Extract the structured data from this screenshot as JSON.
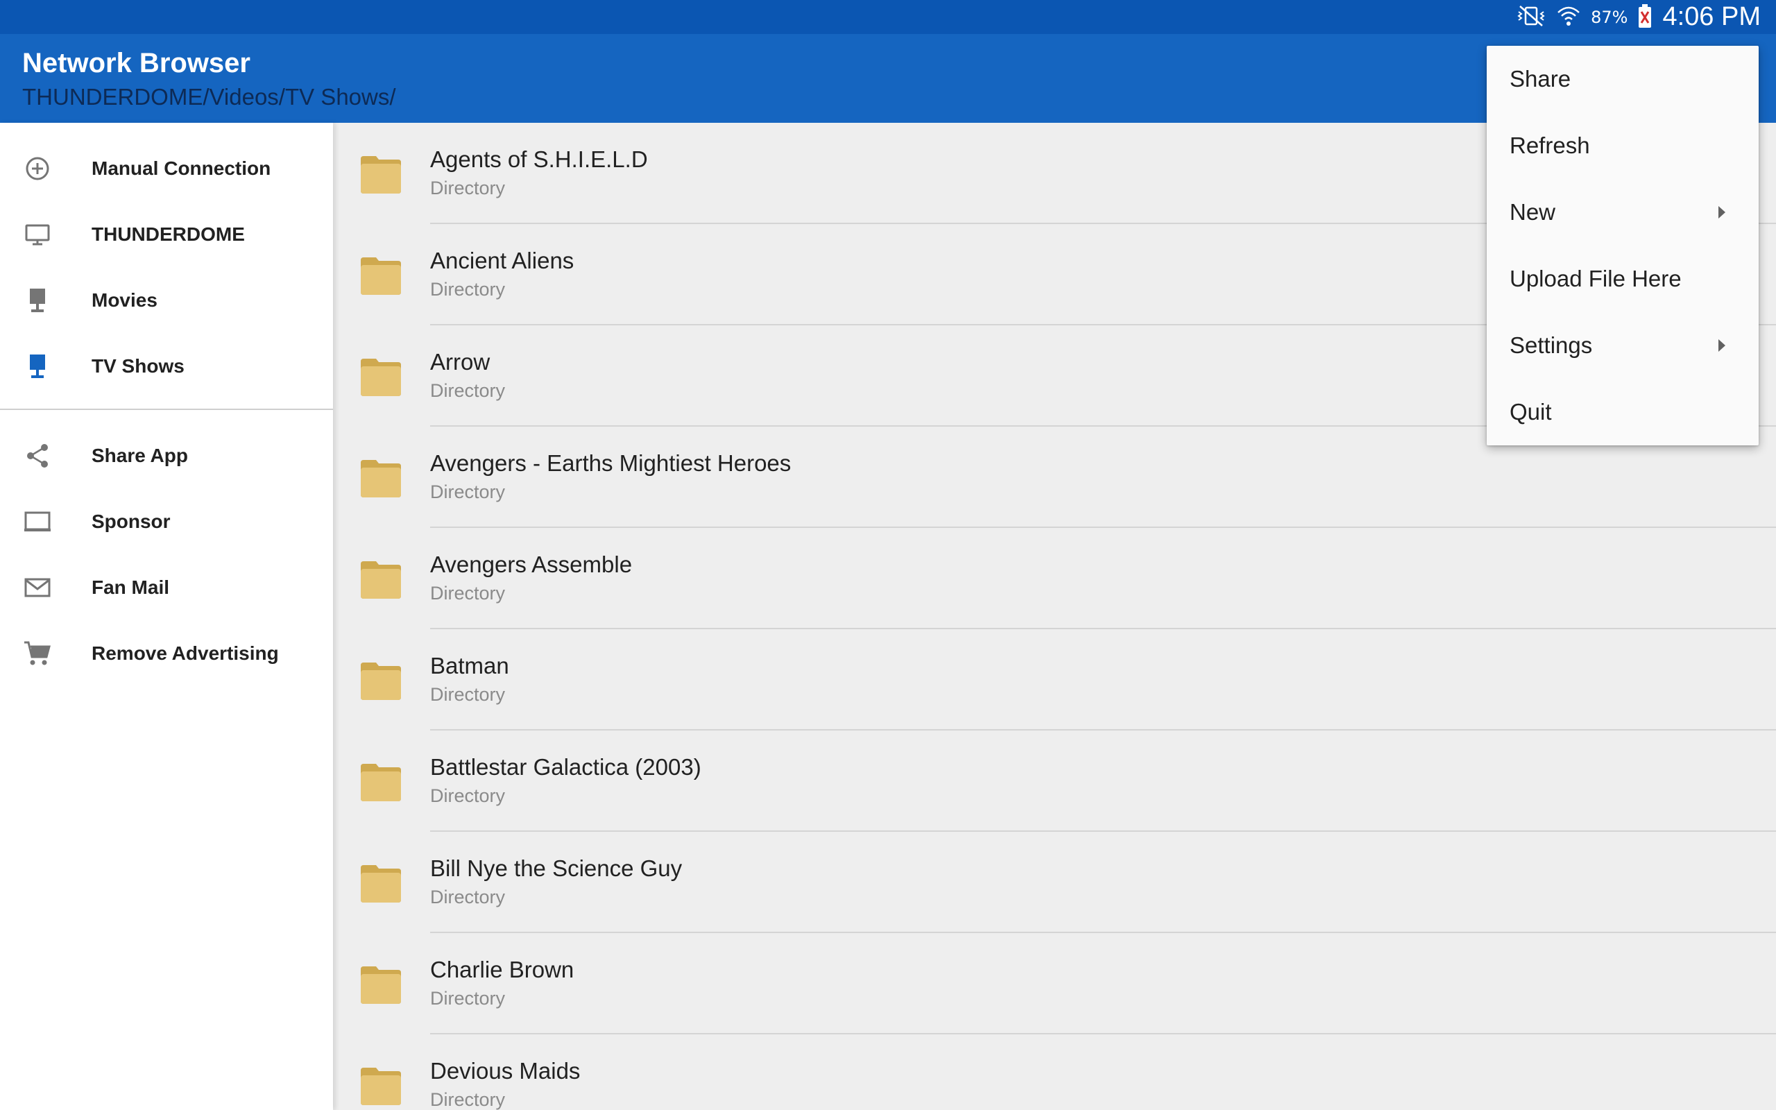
{
  "status_bar": {
    "battery_percent": "87%",
    "time": "4:06 PM",
    "icons": [
      "vibrate-mute-icon",
      "wifi-icon",
      "battery-icon"
    ]
  },
  "app_bar": {
    "title": "Network Browser",
    "path": "THUNDERDOME/Videos/TV Shows/"
  },
  "drawer": {
    "items": [
      {
        "label": "Manual Connection",
        "icon": "add-circle-icon"
      },
      {
        "label": "THUNDERDOME",
        "icon": "monitor-icon"
      },
      {
        "label": "Movies",
        "icon": "share-folder-icon"
      },
      {
        "label": "TV Shows",
        "icon": "share-folder-icon"
      },
      {
        "label": "Share App",
        "icon": "share-icon"
      },
      {
        "label": "Sponsor",
        "icon": "laptop-icon"
      },
      {
        "label": "Fan Mail",
        "icon": "mail-icon"
      },
      {
        "label": "Remove Advertising",
        "icon": "cart-icon"
      }
    ],
    "active_color": "#1565c0"
  },
  "files": [
    {
      "name": "Agents of S.H.I.E.L.D",
      "type": "Directory"
    },
    {
      "name": "Ancient Aliens",
      "type": "Directory"
    },
    {
      "name": "Arrow",
      "type": "Directory"
    },
    {
      "name": "Avengers - Earths Mightiest Heroes",
      "type": "Directory"
    },
    {
      "name": "Avengers Assemble",
      "type": "Directory"
    },
    {
      "name": "Batman",
      "type": "Directory"
    },
    {
      "name": "Battlestar Galactica (2003)",
      "type": "Directory"
    },
    {
      "name": "Bill Nye the Science Guy",
      "type": "Directory"
    },
    {
      "name": "Charlie Brown",
      "type": "Directory"
    },
    {
      "name": "Devious Maids",
      "type": "Directory"
    }
  ],
  "menu": {
    "items": [
      {
        "label": "Share",
        "submenu": false
      },
      {
        "label": "Refresh",
        "submenu": false
      },
      {
        "label": "New",
        "submenu": true
      },
      {
        "label": "Upload File Here",
        "submenu": false
      },
      {
        "label": "Settings",
        "submenu": true
      },
      {
        "label": "Quit",
        "submenu": false
      }
    ]
  },
  "colors": {
    "status_bar": "#0b56b2",
    "app_bar": "#1565c0",
    "folder": "#e2c270"
  }
}
